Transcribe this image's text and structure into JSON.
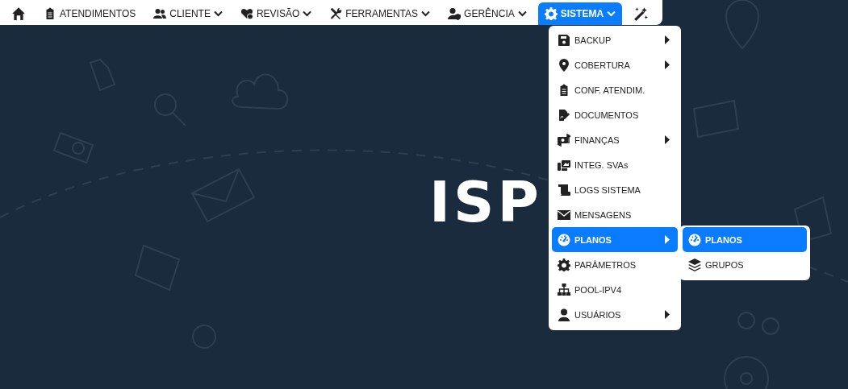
{
  "top_menu": [
    {
      "kind": "icon",
      "selected": false
    },
    {
      "kind": "item",
      "label": "ATENDIMENTOS",
      "selected": false
    },
    {
      "kind": "dropdown",
      "label": "CLIENTE",
      "selected": false
    },
    {
      "kind": "dropdown",
      "label": "REVISÃO",
      "selected": false
    },
    {
      "kind": "dropdown",
      "label": "FERRAMENTAS",
      "selected": false
    },
    {
      "kind": "dropdown",
      "label": "GERÊNCIA",
      "selected": false
    },
    {
      "kind": "dropdown",
      "label": "SISTEMA",
      "selected": true
    },
    {
      "kind": "icon",
      "selected": false
    }
  ],
  "logo": {
    "text": "ISP"
  },
  "menu": {
    "items": [
      {
        "label": "BACKUP",
        "has_submenu": true,
        "selected": false
      },
      {
        "label": "COBERTURA",
        "has_submenu": true,
        "selected": false
      },
      {
        "label": "CONF. ATENDIM.",
        "has_submenu": false,
        "selected": false
      },
      {
        "label": "DOCUMENTOS",
        "has_submenu": false,
        "selected": false
      },
      {
        "label": "FINANÇAS",
        "has_submenu": true,
        "selected": false
      },
      {
        "label": "INTEG. SVAs",
        "has_submenu": false,
        "selected": false
      },
      {
        "label": "LOGS SISTEMA",
        "has_submenu": false,
        "selected": false
      },
      {
        "label": "MENSAGENS",
        "has_submenu": false,
        "selected": false
      },
      {
        "label": "PLANOS",
        "has_submenu": true,
        "selected": true
      },
      {
        "label": "PARÂMETROS",
        "has_submenu": false,
        "selected": false
      },
      {
        "label": "POOL-IPV4",
        "has_submenu": false,
        "selected": false
      },
      {
        "label": "USUÁRIOS",
        "has_submenu": true,
        "selected": false
      }
    ]
  },
  "submenu": {
    "items": [
      {
        "label": "PLANOS",
        "selected": true
      },
      {
        "label": "GRUPOS",
        "selected": false
      }
    ]
  }
}
